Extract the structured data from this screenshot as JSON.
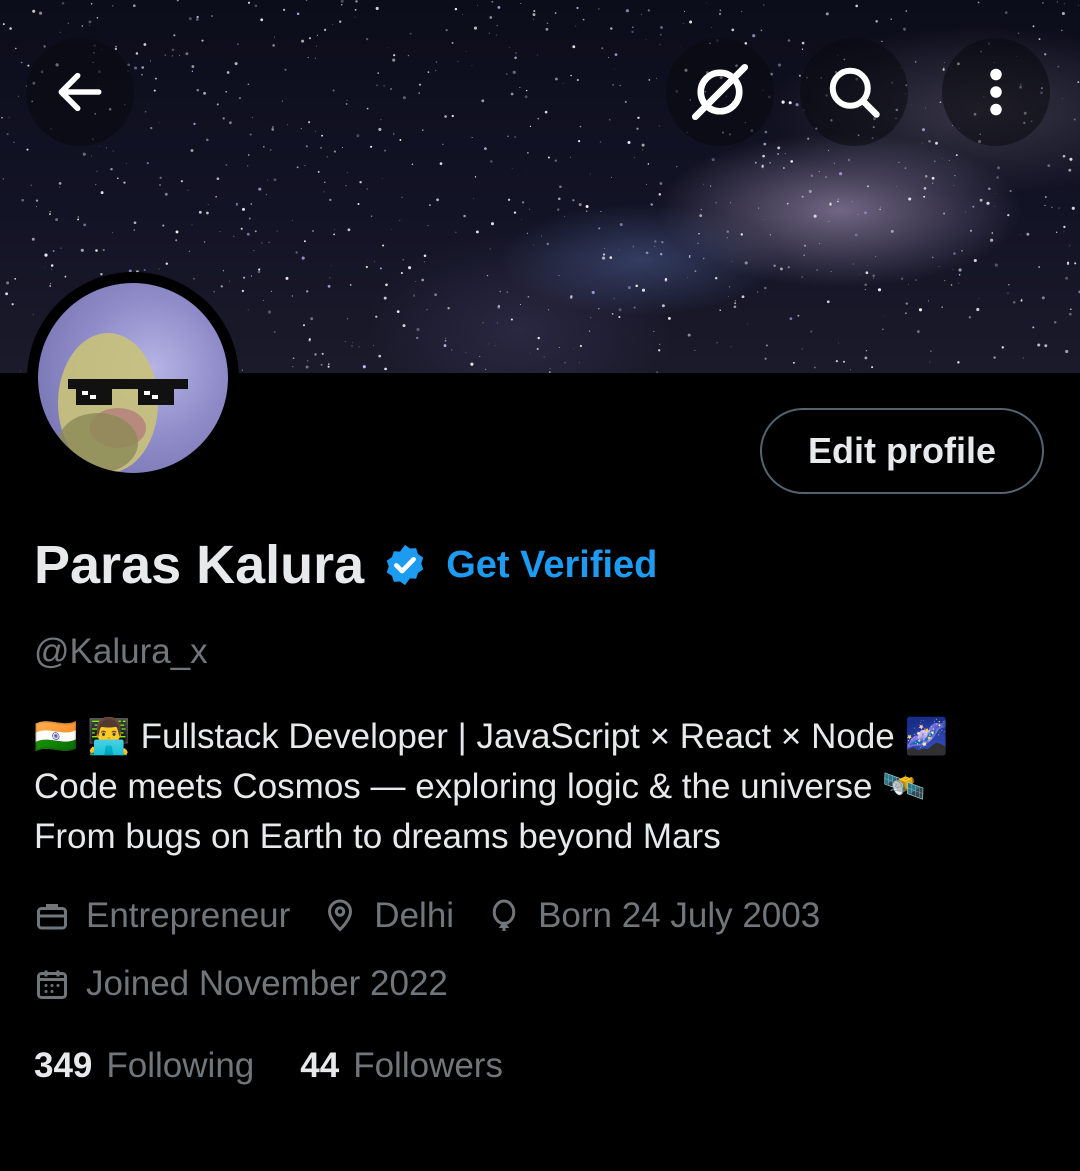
{
  "header": {
    "back_icon": "arrow-left-icon",
    "grok_icon": "grok-icon",
    "search_icon": "search-icon",
    "more_icon": "more-vertical-icon"
  },
  "profile": {
    "name": "Paras Kalura",
    "verified_badge": "verified-badge-icon",
    "get_verified": "Get Verified",
    "handle": "@Kalura_x",
    "edit_profile": "Edit profile",
    "bio": [
      "🇮🇳 👨‍💻 Fullstack Developer | JavaScript × React × Node 🌌",
      "Code meets Cosmos — exploring logic & the universe 🛰️",
      "From bugs on Earth to dreams beyond Mars"
    ],
    "meta": {
      "profession": "Entrepreneur",
      "location": "Delhi",
      "birthday": "Born 24 July 2003",
      "joined": "Joined November 2022"
    },
    "stats": {
      "following_count": "349",
      "following_label": "Following",
      "followers_count": "44",
      "followers_label": "Followers"
    }
  },
  "colors": {
    "background": "#000000",
    "primary_text": "#e7e9ea",
    "secondary_text": "#71767b",
    "accent": "#1d9bf0",
    "border": "#536471"
  }
}
